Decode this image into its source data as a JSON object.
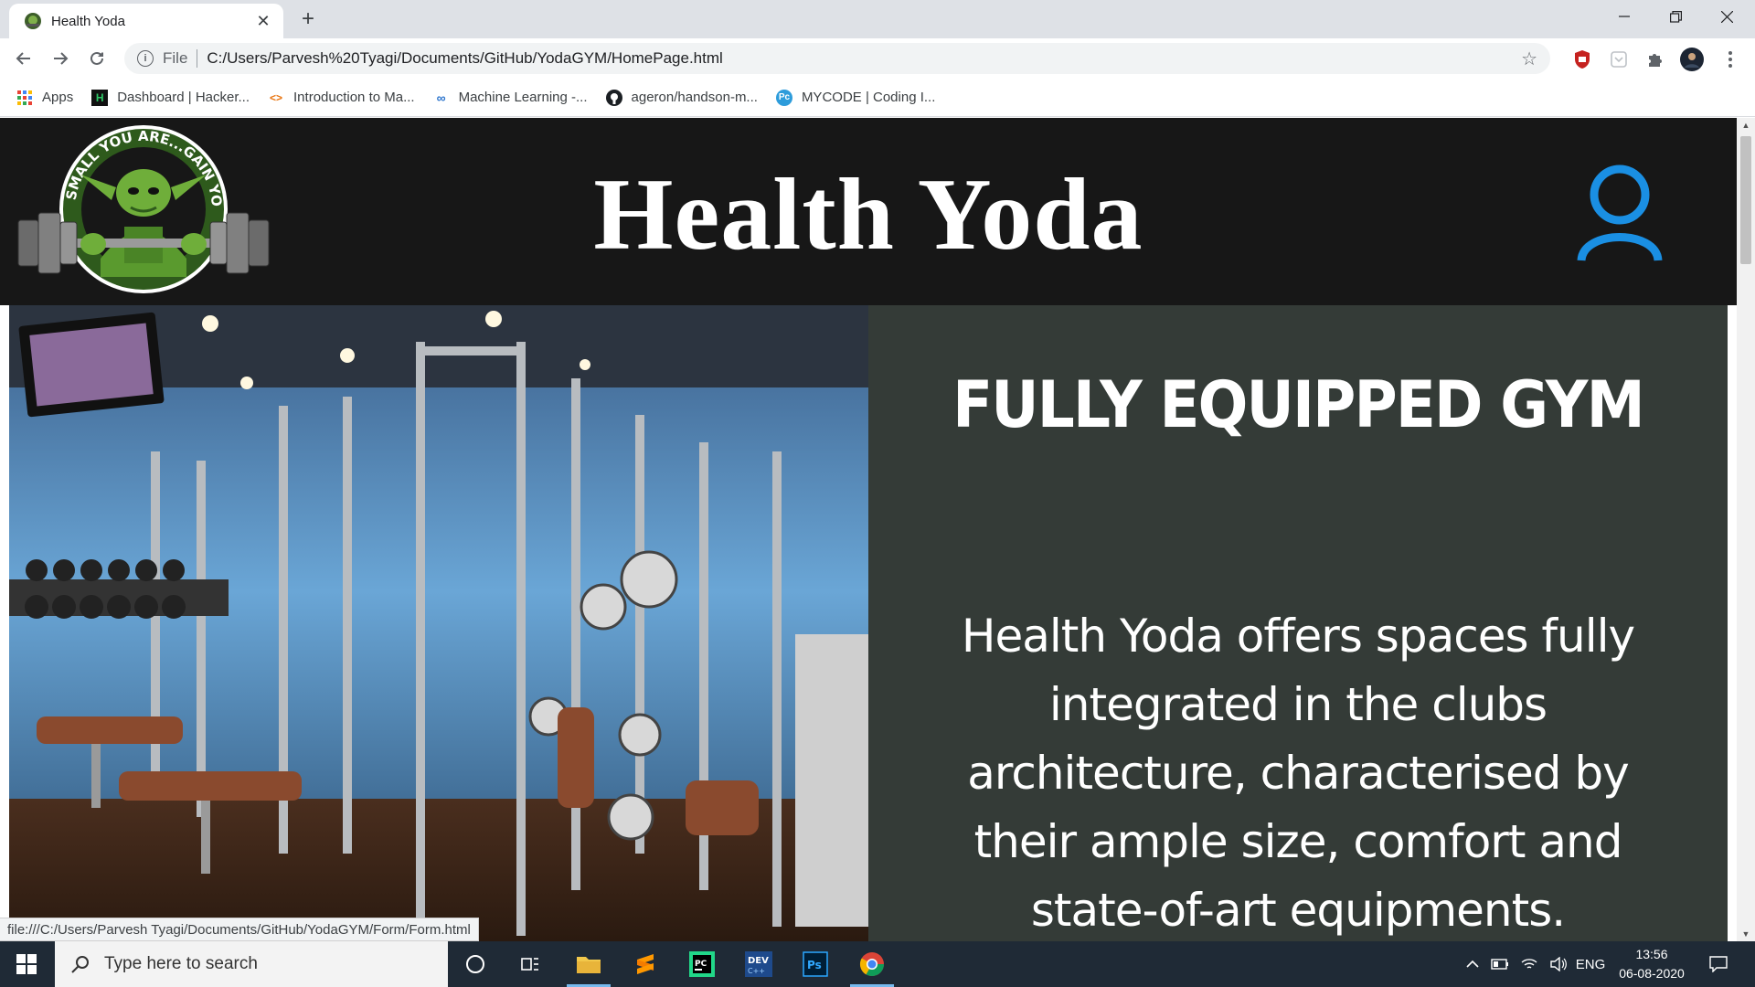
{
  "browser": {
    "tab_title": "Health Yoda",
    "scheme_label": "File",
    "url": "C:/Users/Parvesh%20Tyagi/Documents/GitHub/YodaGYM/HomePage.html",
    "status_url": "file:///C:/Users/Parvesh Tyagi/Documents/GitHub/YodaGYM/Form/Form.html"
  },
  "bookmarks": [
    {
      "label": "Apps",
      "icon": "apps-grid-icon"
    },
    {
      "label": "Dashboard | Hacker...",
      "icon": "hackerrank-icon"
    },
    {
      "label": "Introduction to Ma...",
      "icon": "code-brackets-icon"
    },
    {
      "label": "Machine Learning -...",
      "icon": "coursera-icon"
    },
    {
      "label": "ageron/handson-m...",
      "icon": "github-icon"
    },
    {
      "label": "MYCODE | Coding I...",
      "icon": "mycode-icon"
    }
  ],
  "site": {
    "logo_text": "SMALL YOU ARE...GAIN YOU MUST",
    "title": "Health Yoda",
    "hero_heading": "FULLY EQUIPPED GYM",
    "hero_text": "Health Yoda offers spaces fully integrated in the clubs architecture, characterised by their ample size, comfort and state-of-art equipments."
  },
  "taskbar": {
    "search_placeholder": "Type here to search",
    "language": "ENG",
    "time": "13:56",
    "date": "06-08-2020"
  },
  "colors": {
    "header_bg": "#171717",
    "panel_bg": "#343b37",
    "user_icon": "#1a8fe3",
    "logo_green": "#5aa02c"
  }
}
